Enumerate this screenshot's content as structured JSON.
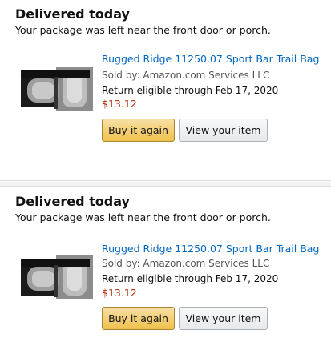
{
  "orders": [
    {
      "status_title": "Delivered today",
      "status_detail": "Your package was left near the front door or porch.",
      "product": {
        "title": "Rugged Ridge 11250.07 Sport Bar Trail Bag",
        "seller": "Sold by: Amazon.com Services LLC",
        "return_note": "Return eligible through Feb 17, 2020",
        "price": "$13.12",
        "image_icon": "product-photo-trail-bag"
      },
      "buttons": {
        "buy_again": "Buy it again",
        "view_item": "View your item"
      }
    },
    {
      "status_title": "Delivered today",
      "status_detail": "Your package was left near the front door or porch.",
      "product": {
        "title": "Rugged Ridge 11250.07 Sport Bar Trail Bag",
        "seller": "Sold by: Amazon.com Services LLC",
        "return_note": "Return eligible through Feb 17, 2020",
        "price": "$13.12",
        "image_icon": "product-photo-trail-bag"
      },
      "buttons": {
        "buy_again": "Buy it again",
        "view_item": "View your item"
      }
    }
  ],
  "colors": {
    "link": "#0066c0",
    "price": "#b12704",
    "primary_button": "#f0c14b",
    "secondary_button": "#e7e9ec"
  }
}
